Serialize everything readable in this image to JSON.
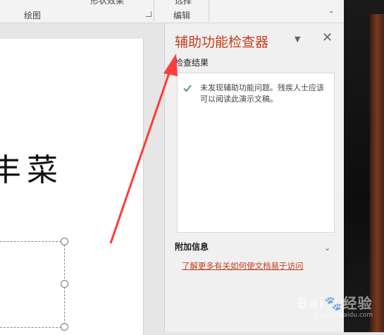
{
  "ribbon": {
    "cut_button_label": "形状效果",
    "select_label": "选择",
    "groups": [
      "绘图",
      "编辑"
    ]
  },
  "slide": {
    "partial_text": "菜"
  },
  "task_pane": {
    "title": "辅助功能检查器",
    "results_section_label": "检查结果",
    "result_message": "未发现辅助功能问题。残疾人士应该可以阅读此演示文稿。",
    "additional_info_label": "附加信息",
    "help_link": "了解更多有关如何使文档易于访问"
  },
  "watermark": {
    "brand": "Bai",
    "brand_suffix": "经验",
    "url": "jingyan.baidu.com"
  },
  "colors": {
    "accent": "#c43e1c",
    "check": "#4a9a8a",
    "arrow": "#ff3b3b"
  },
  "icons": [
    "check-icon",
    "chevron-down-icon",
    "close-icon",
    "dialog-launcher-icon",
    "paw-icon"
  ]
}
